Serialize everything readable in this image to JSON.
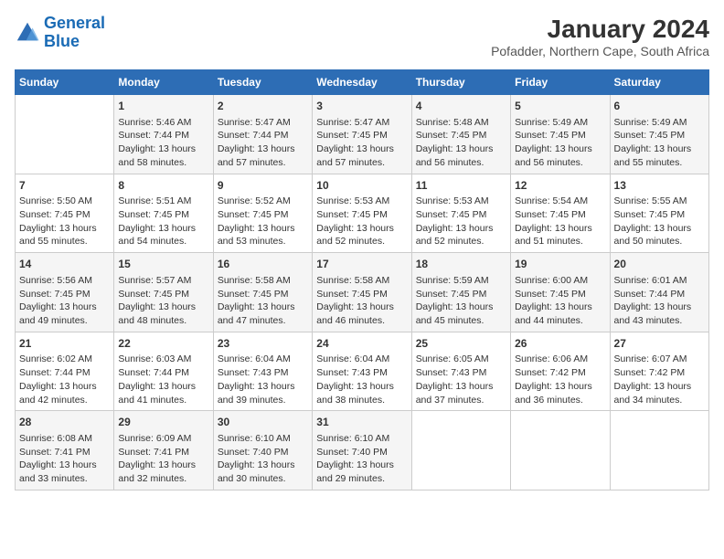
{
  "header": {
    "logo_general": "General",
    "logo_blue": "Blue",
    "month_year": "January 2024",
    "location": "Pofadder, Northern Cape, South Africa"
  },
  "days_of_week": [
    "Sunday",
    "Monday",
    "Tuesday",
    "Wednesday",
    "Thursday",
    "Friday",
    "Saturday"
  ],
  "weeks": [
    [
      {
        "day": "",
        "sunrise": "",
        "sunset": "",
        "daylight": ""
      },
      {
        "day": "1",
        "sunrise": "Sunrise: 5:46 AM",
        "sunset": "Sunset: 7:44 PM",
        "daylight": "Daylight: 13 hours and 58 minutes."
      },
      {
        "day": "2",
        "sunrise": "Sunrise: 5:47 AM",
        "sunset": "Sunset: 7:44 PM",
        "daylight": "Daylight: 13 hours and 57 minutes."
      },
      {
        "day": "3",
        "sunrise": "Sunrise: 5:47 AM",
        "sunset": "Sunset: 7:45 PM",
        "daylight": "Daylight: 13 hours and 57 minutes."
      },
      {
        "day": "4",
        "sunrise": "Sunrise: 5:48 AM",
        "sunset": "Sunset: 7:45 PM",
        "daylight": "Daylight: 13 hours and 56 minutes."
      },
      {
        "day": "5",
        "sunrise": "Sunrise: 5:49 AM",
        "sunset": "Sunset: 7:45 PM",
        "daylight": "Daylight: 13 hours and 56 minutes."
      },
      {
        "day": "6",
        "sunrise": "Sunrise: 5:49 AM",
        "sunset": "Sunset: 7:45 PM",
        "daylight": "Daylight: 13 hours and 55 minutes."
      }
    ],
    [
      {
        "day": "7",
        "sunrise": "Sunrise: 5:50 AM",
        "sunset": "Sunset: 7:45 PM",
        "daylight": "Daylight: 13 hours and 55 minutes."
      },
      {
        "day": "8",
        "sunrise": "Sunrise: 5:51 AM",
        "sunset": "Sunset: 7:45 PM",
        "daylight": "Daylight: 13 hours and 54 minutes."
      },
      {
        "day": "9",
        "sunrise": "Sunrise: 5:52 AM",
        "sunset": "Sunset: 7:45 PM",
        "daylight": "Daylight: 13 hours and 53 minutes."
      },
      {
        "day": "10",
        "sunrise": "Sunrise: 5:53 AM",
        "sunset": "Sunset: 7:45 PM",
        "daylight": "Daylight: 13 hours and 52 minutes."
      },
      {
        "day": "11",
        "sunrise": "Sunrise: 5:53 AM",
        "sunset": "Sunset: 7:45 PM",
        "daylight": "Daylight: 13 hours and 52 minutes."
      },
      {
        "day": "12",
        "sunrise": "Sunrise: 5:54 AM",
        "sunset": "Sunset: 7:45 PM",
        "daylight": "Daylight: 13 hours and 51 minutes."
      },
      {
        "day": "13",
        "sunrise": "Sunrise: 5:55 AM",
        "sunset": "Sunset: 7:45 PM",
        "daylight": "Daylight: 13 hours and 50 minutes."
      }
    ],
    [
      {
        "day": "14",
        "sunrise": "Sunrise: 5:56 AM",
        "sunset": "Sunset: 7:45 PM",
        "daylight": "Daylight: 13 hours and 49 minutes."
      },
      {
        "day": "15",
        "sunrise": "Sunrise: 5:57 AM",
        "sunset": "Sunset: 7:45 PM",
        "daylight": "Daylight: 13 hours and 48 minutes."
      },
      {
        "day": "16",
        "sunrise": "Sunrise: 5:58 AM",
        "sunset": "Sunset: 7:45 PM",
        "daylight": "Daylight: 13 hours and 47 minutes."
      },
      {
        "day": "17",
        "sunrise": "Sunrise: 5:58 AM",
        "sunset": "Sunset: 7:45 PM",
        "daylight": "Daylight: 13 hours and 46 minutes."
      },
      {
        "day": "18",
        "sunrise": "Sunrise: 5:59 AM",
        "sunset": "Sunset: 7:45 PM",
        "daylight": "Daylight: 13 hours and 45 minutes."
      },
      {
        "day": "19",
        "sunrise": "Sunrise: 6:00 AM",
        "sunset": "Sunset: 7:45 PM",
        "daylight": "Daylight: 13 hours and 44 minutes."
      },
      {
        "day": "20",
        "sunrise": "Sunrise: 6:01 AM",
        "sunset": "Sunset: 7:44 PM",
        "daylight": "Daylight: 13 hours and 43 minutes."
      }
    ],
    [
      {
        "day": "21",
        "sunrise": "Sunrise: 6:02 AM",
        "sunset": "Sunset: 7:44 PM",
        "daylight": "Daylight: 13 hours and 42 minutes."
      },
      {
        "day": "22",
        "sunrise": "Sunrise: 6:03 AM",
        "sunset": "Sunset: 7:44 PM",
        "daylight": "Daylight: 13 hours and 41 minutes."
      },
      {
        "day": "23",
        "sunrise": "Sunrise: 6:04 AM",
        "sunset": "Sunset: 7:43 PM",
        "daylight": "Daylight: 13 hours and 39 minutes."
      },
      {
        "day": "24",
        "sunrise": "Sunrise: 6:04 AM",
        "sunset": "Sunset: 7:43 PM",
        "daylight": "Daylight: 13 hours and 38 minutes."
      },
      {
        "day": "25",
        "sunrise": "Sunrise: 6:05 AM",
        "sunset": "Sunset: 7:43 PM",
        "daylight": "Daylight: 13 hours and 37 minutes."
      },
      {
        "day": "26",
        "sunrise": "Sunrise: 6:06 AM",
        "sunset": "Sunset: 7:42 PM",
        "daylight": "Daylight: 13 hours and 36 minutes."
      },
      {
        "day": "27",
        "sunrise": "Sunrise: 6:07 AM",
        "sunset": "Sunset: 7:42 PM",
        "daylight": "Daylight: 13 hours and 34 minutes."
      }
    ],
    [
      {
        "day": "28",
        "sunrise": "Sunrise: 6:08 AM",
        "sunset": "Sunset: 7:41 PM",
        "daylight": "Daylight: 13 hours and 33 minutes."
      },
      {
        "day": "29",
        "sunrise": "Sunrise: 6:09 AM",
        "sunset": "Sunset: 7:41 PM",
        "daylight": "Daylight: 13 hours and 32 minutes."
      },
      {
        "day": "30",
        "sunrise": "Sunrise: 6:10 AM",
        "sunset": "Sunset: 7:40 PM",
        "daylight": "Daylight: 13 hours and 30 minutes."
      },
      {
        "day": "31",
        "sunrise": "Sunrise: 6:10 AM",
        "sunset": "Sunset: 7:40 PM",
        "daylight": "Daylight: 13 hours and 29 minutes."
      },
      {
        "day": "",
        "sunrise": "",
        "sunset": "",
        "daylight": ""
      },
      {
        "day": "",
        "sunrise": "",
        "sunset": "",
        "daylight": ""
      },
      {
        "day": "",
        "sunrise": "",
        "sunset": "",
        "daylight": ""
      }
    ]
  ]
}
